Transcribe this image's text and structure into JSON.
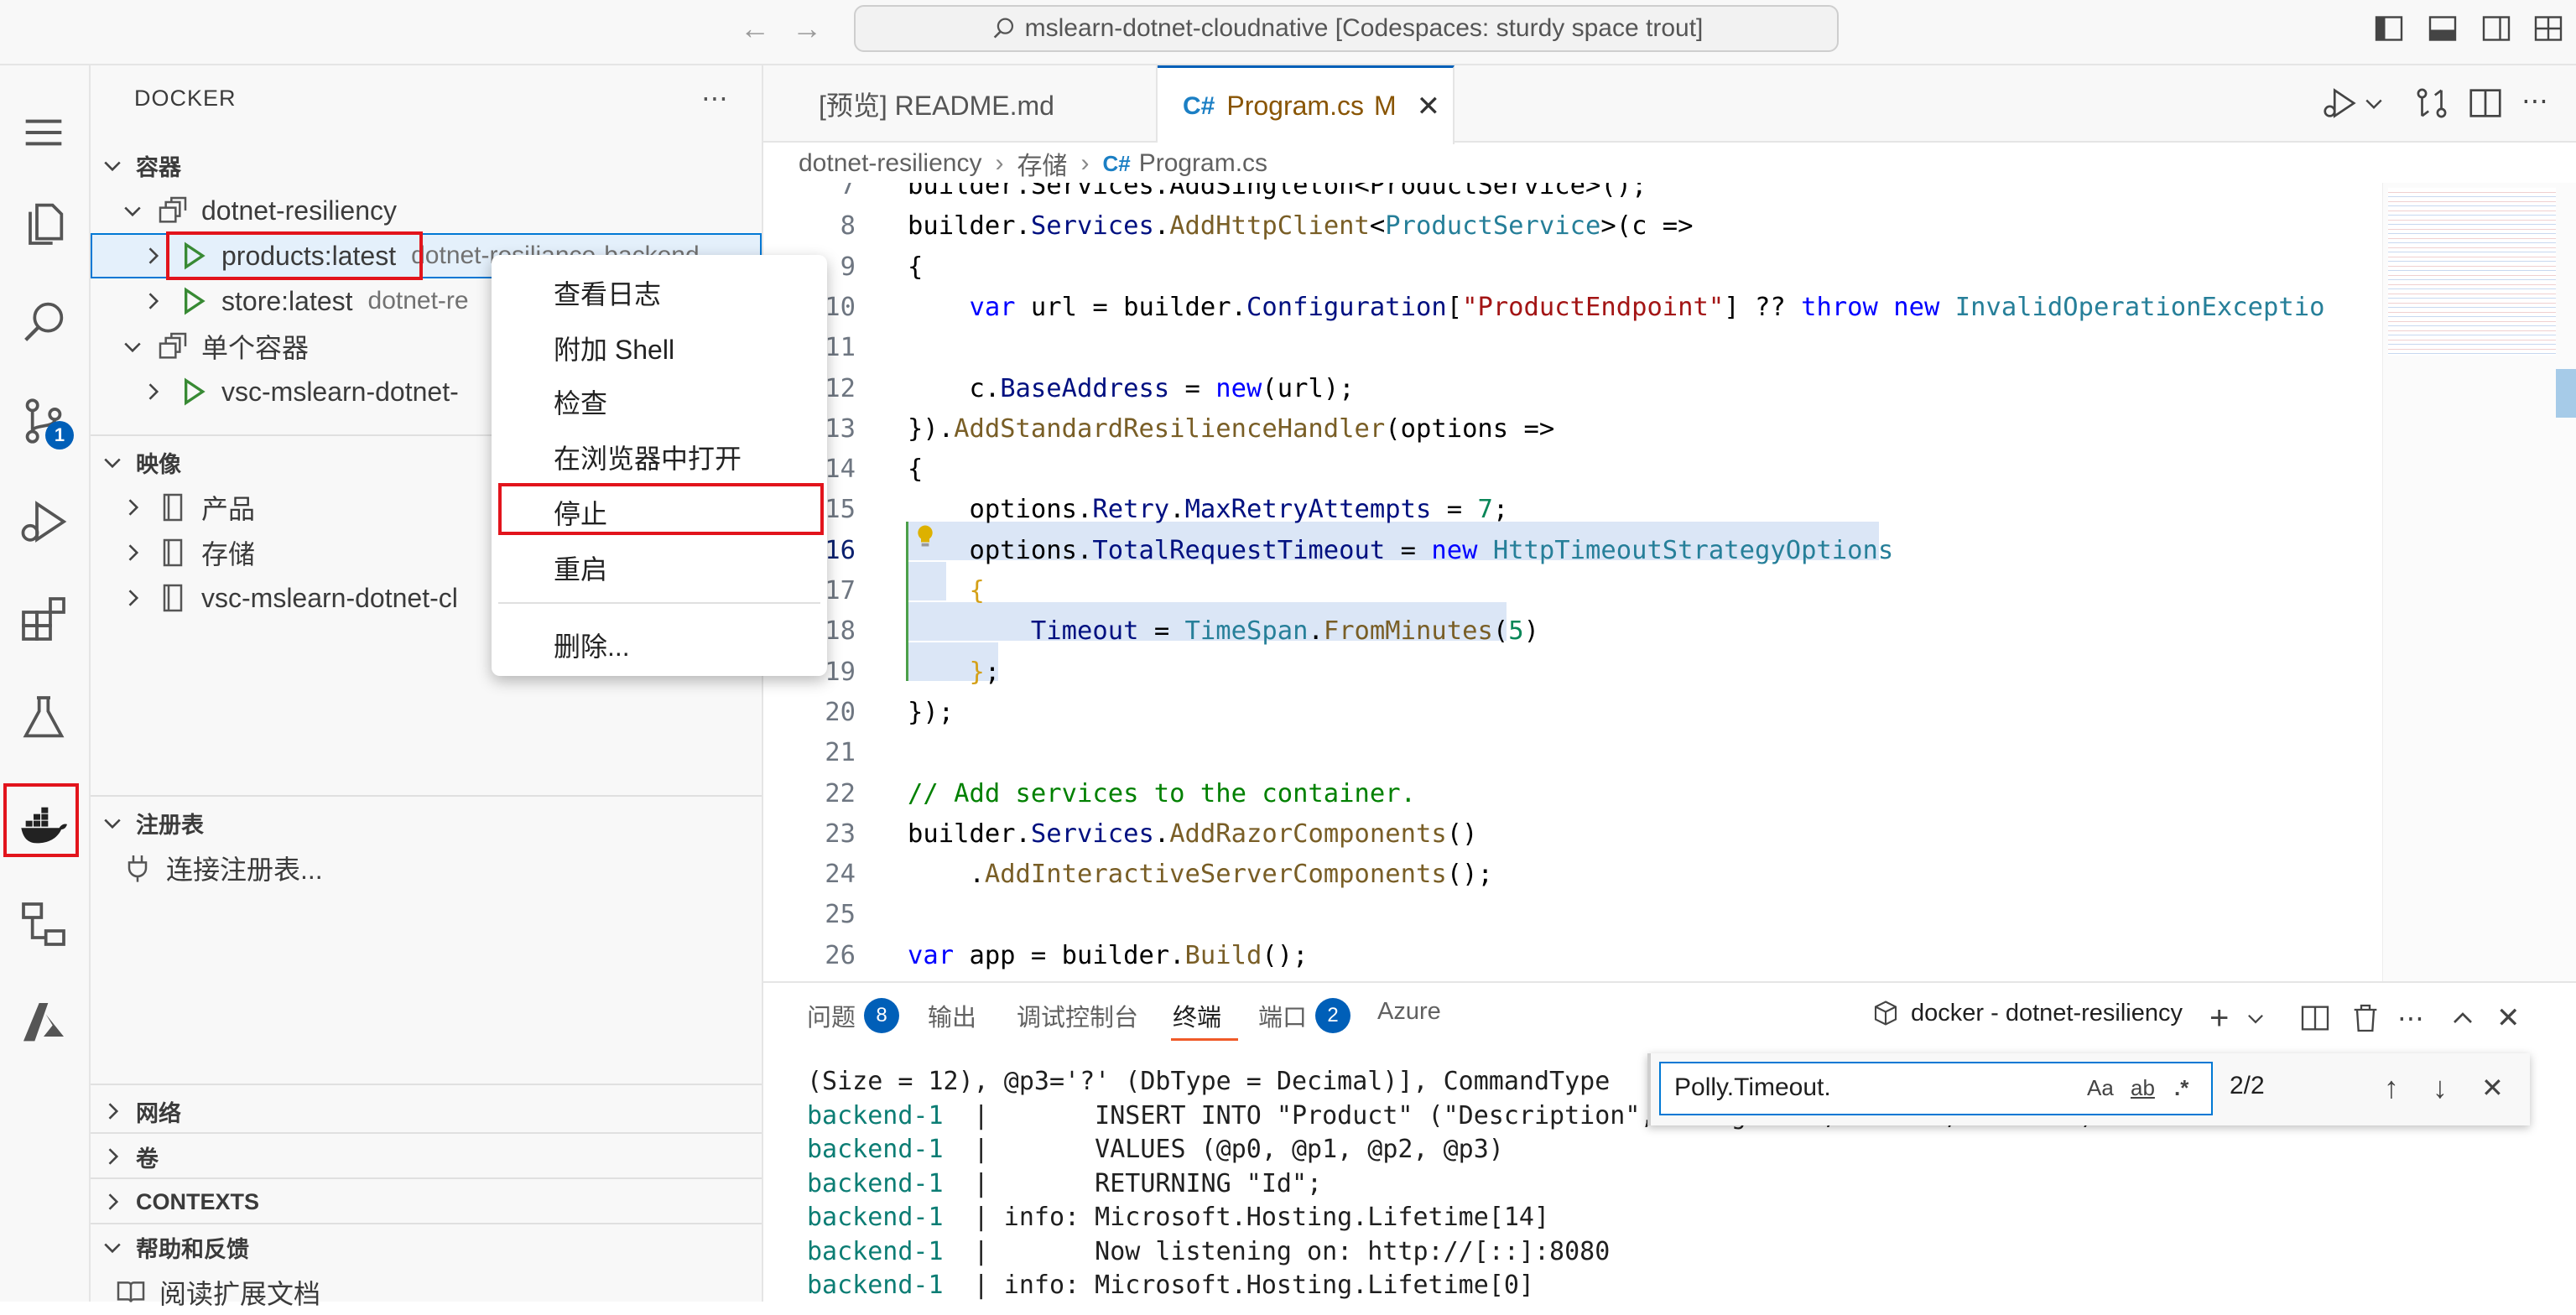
{
  "titlebar": {
    "search_text": "mslearn-dotnet-cloudnative [Codespaces: sturdy space trout]"
  },
  "activity_bar": {
    "source_control_badge": "1"
  },
  "sidebar": {
    "title": "DOCKER",
    "containers_section": "容器",
    "group_name": "dotnet-resiliency",
    "container_1": {
      "name": "products:latest",
      "desc": "dotnet-resiliance-backend"
    },
    "container_2": {
      "name": "store:latest",
      "desc": "dotnet-re"
    },
    "single_group": "单个容器",
    "single_container": "vsc-mslearn-dotnet-",
    "images_section": "映像",
    "images": [
      "产品",
      "存储",
      "vsc-mslearn-dotnet-cl"
    ],
    "registries_section": "注册表",
    "connect_registry": "连接注册表...",
    "networks_section": "网络",
    "volumes_section": "卷",
    "contexts_section": "CONTEXTS",
    "help_section": "帮助和反馈",
    "read_docs": "阅读扩展文档"
  },
  "context_menu": {
    "items": [
      "查看日志",
      "附加 Shell",
      "检查",
      "在浏览器中打开",
      "停止",
      "重启",
      "删除..."
    ]
  },
  "editor": {
    "tabs": [
      {
        "label": "[预览] README.md"
      },
      {
        "label": "Program.cs",
        "modified": "M"
      }
    ],
    "breadcrumb": [
      "dotnet-resiliency",
      "存储",
      "Program.cs"
    ]
  },
  "code_lines": [
    {
      "n": "7",
      "html": "builder.Services.AddSingleton&lt;ProductService&gt;();"
    },
    {
      "n": "8",
      "html": "builder.<span class=\"pr\">Services</span>.<span class=\"fn\">AddHttpClient</span>&lt;<span class=\"ty\">ProductService</span>&gt;(c =&gt;"
    },
    {
      "n": "9",
      "html": "{"
    },
    {
      "n": "10",
      "html": "    <span class=\"kw\">var</span> url = builder.<span class=\"pr\">Configuration</span>[<span class=\"str\">\"ProductEndpoint\"</span>] ?? <span class=\"kw\">throw new</span> <span class=\"ty\">InvalidOperationExceptio</span>"
    },
    {
      "n": "11",
      "html": ""
    },
    {
      "n": "12",
      "html": "    c.<span class=\"pr\">BaseAddress</span> = <span class=\"kw\">new</span>(url);"
    },
    {
      "n": "13",
      "html": "}).<span class=\"fn\">AddStandardResilienceHandler</span>(options =&gt;"
    },
    {
      "n": "14",
      "html": "{"
    },
    {
      "n": "15",
      "html": "    options.<span class=\"pr\">Retry</span>.<span class=\"pr\">MaxRetryAttempts</span> = <span class=\"num\">7</span>;"
    },
    {
      "n": "16",
      "html": "    options.<span class=\"pr\">TotalRequestTimeout</span> = <span class=\"kw\">new</span> <span class=\"ty\">HttpTimeoutStrategyOptions</span>"
    },
    {
      "n": "17",
      "html": "    <span class=\"vi\">{</span>"
    },
    {
      "n": "18",
      "html": "        <span class=\"pr\">Timeout</span> = <span class=\"ty\">TimeSpan</span>.<span class=\"fn\">FromMinutes</span>(<span class=\"num\">5</span>)"
    },
    {
      "n": "19",
      "html": "    <span class=\"vi\">}</span>;"
    },
    {
      "n": "20",
      "html": "});"
    },
    {
      "n": "21",
      "html": ""
    },
    {
      "n": "22",
      "html": "<span class=\"cm\">// Add services to the container.</span>"
    },
    {
      "n": "23",
      "html": "builder.<span class=\"pr\">Services</span>.<span class=\"fn\">AddRazorComponents</span>()"
    },
    {
      "n": "24",
      "html": "    .<span class=\"fn\">AddInteractiveServerComponents</span>();"
    },
    {
      "n": "25",
      "html": ""
    },
    {
      "n": "26",
      "html": "<span class=\"kw\">var</span> app = builder.<span class=\"fn\">Build</span>();"
    }
  ],
  "panel": {
    "tabs": [
      {
        "label": "问题",
        "badge": "8"
      },
      {
        "label": "输出"
      },
      {
        "label": "调试控制台"
      },
      {
        "label": "终端"
      },
      {
        "label": "端口",
        "badge": "2"
      },
      {
        "label": "Azure"
      }
    ],
    "terminal_name": "docker - dotnet-resiliency",
    "find": {
      "query": "Polly.Timeout.",
      "count": "2/2",
      "opt_case": "Aa",
      "opt_word": "ab",
      "opt_regex": ".*"
    },
    "terminal_lines": [
      {
        "svc": "",
        "text": "(Size = 12), @p3='?' (DbType = Decimal)], CommandType"
      },
      {
        "svc": "backend-1",
        "text": "  |       INSERT INTO \"Product\" (\"Description\", \"ImageUrl\", \"Name\", \"Price\")"
      },
      {
        "svc": "backend-1",
        "text": "  |       VALUES (@p0, @p1, @p2, @p3)"
      },
      {
        "svc": "backend-1",
        "text": "  |       RETURNING \"Id\";"
      },
      {
        "svc": "backend-1",
        "text": "  | info: Microsoft.Hosting.Lifetime[14]"
      },
      {
        "svc": "backend-1",
        "text": "  |       Now listening on: http://[::]:8080"
      },
      {
        "svc": "backend-1",
        "text": "  | info: Microsoft.Hosting.Lifetime[0]"
      }
    ]
  },
  "colors": {
    "accent": "#005fb8",
    "highlight_border": "#e2141c",
    "selection": "#dbe6f6"
  }
}
